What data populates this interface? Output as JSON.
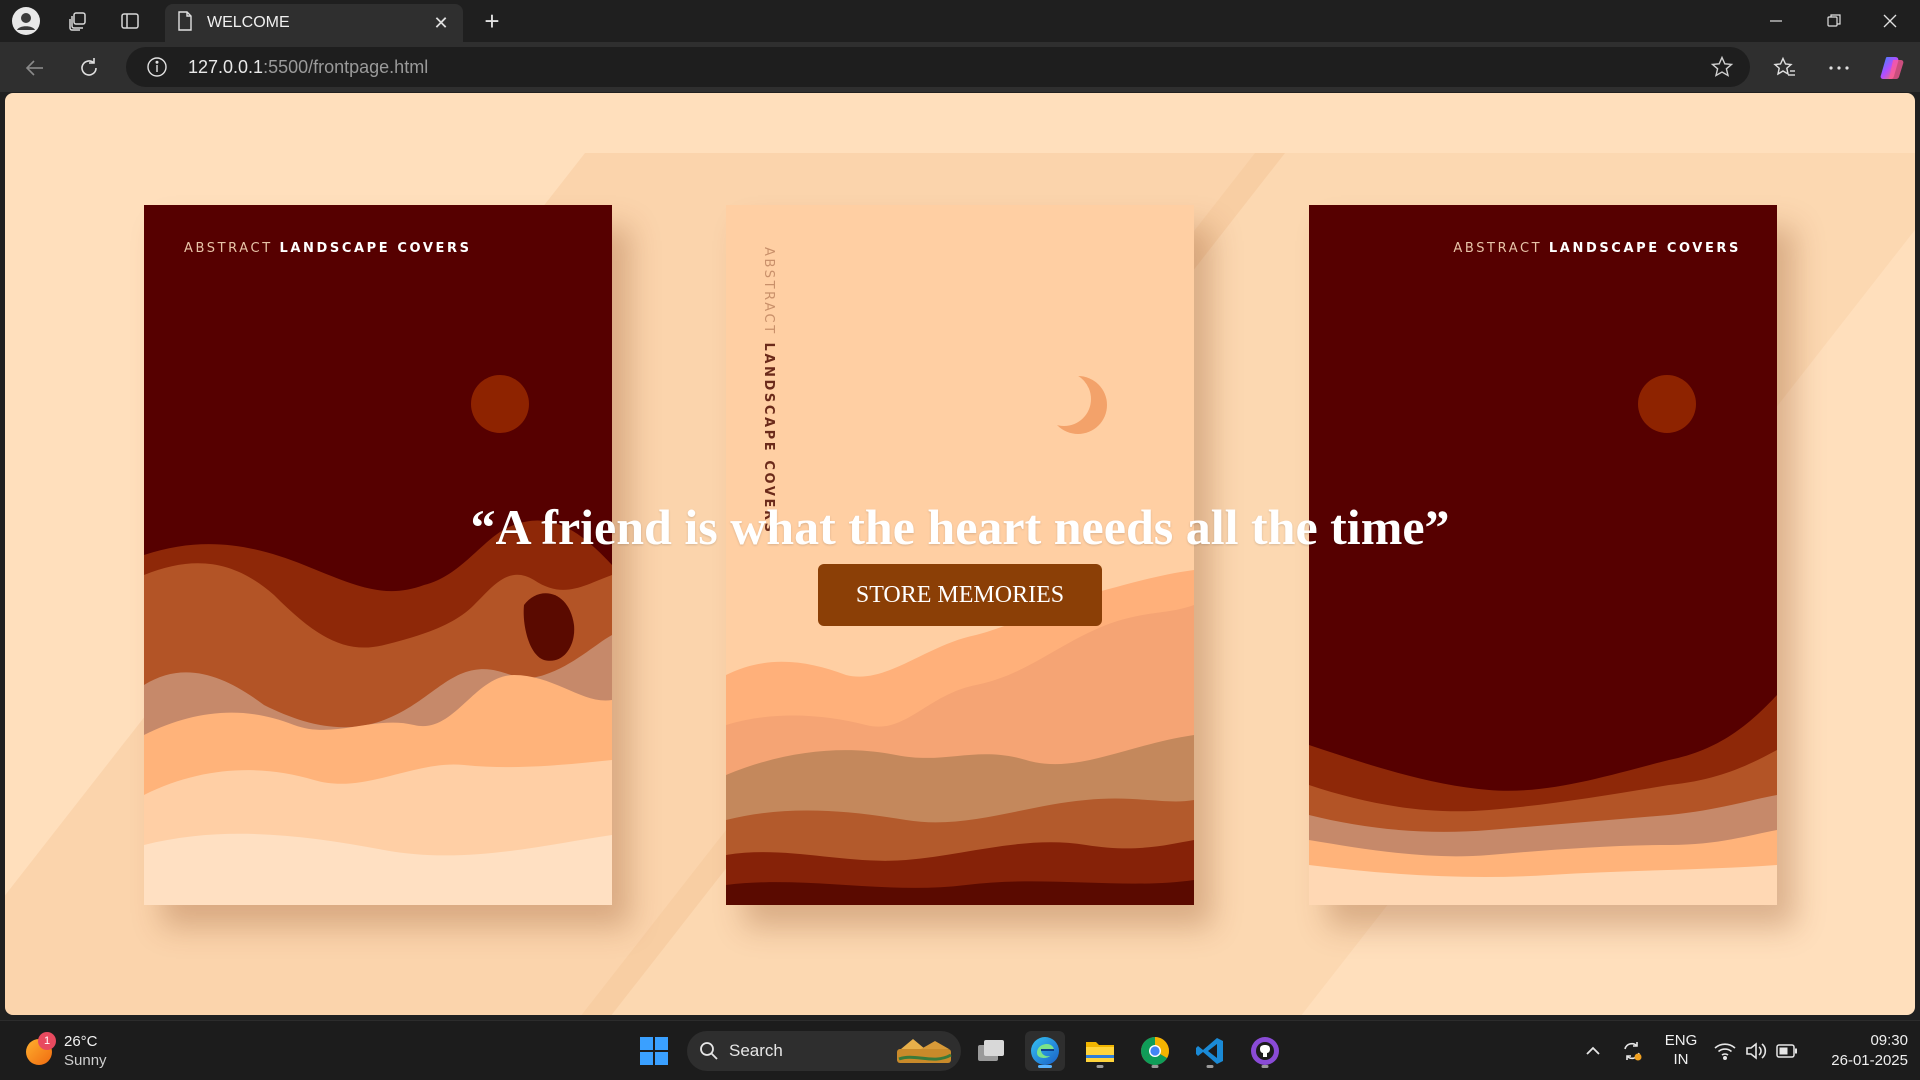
{
  "browser": {
    "tab_title": "WELCOME",
    "url_host": "127.0.0.1",
    "url_rest": ":5500/frontpage.html"
  },
  "page": {
    "cover_left": {
      "label_light": "ABSTRACT",
      "label_bold": "LANDSCAPE COVERS"
    },
    "cover_middle": {
      "label_light": "ABSTRACT",
      "label_bold": "LANDSCAPE COVERS"
    },
    "cover_right": {
      "label_light": "ABSTRACT",
      "label_bold": "LANDSCAPE COVERS"
    },
    "quote": "“A friend is what the heart needs all the time”",
    "cta_label": "STORE MEMORIES"
  },
  "taskbar": {
    "weather_badge": "1",
    "temperature": "26°C",
    "condition": "Sunny",
    "search_label": "Search",
    "lang_top": "ENG",
    "lang_bottom": "IN",
    "time": "09:30",
    "date": "26-01-2025"
  },
  "colors": {
    "page_bg": "#ffdfbc",
    "cta_bg": "#8b3f06",
    "cover_dark": "#560000"
  }
}
